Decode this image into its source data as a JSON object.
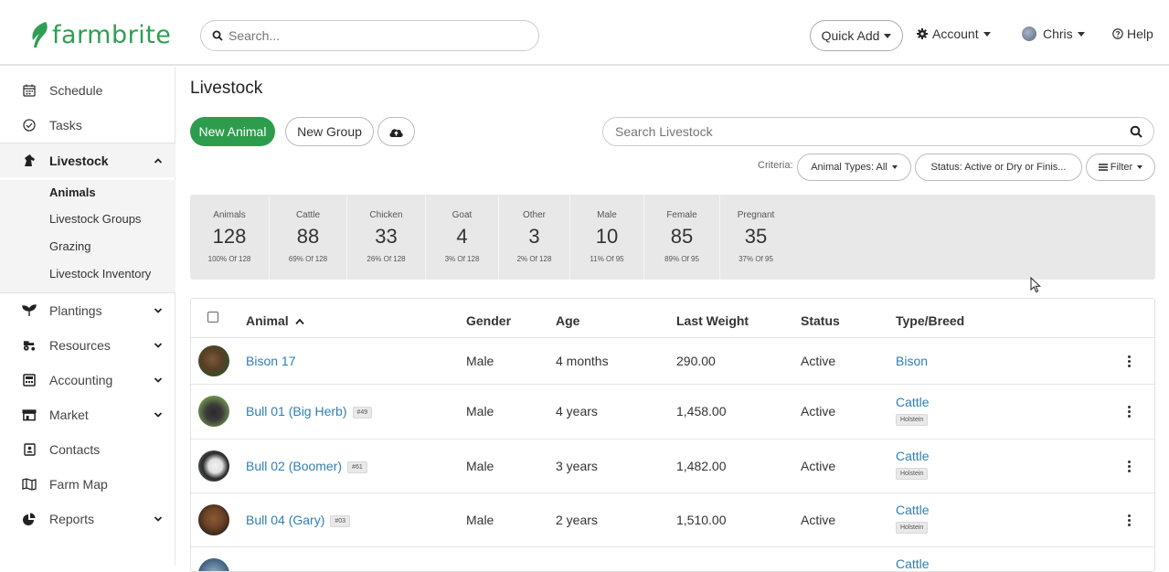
{
  "brand": {
    "name": "farmbrite",
    "color": "#2f9e52"
  },
  "topbar": {
    "search_placeholder": "Search...",
    "quick_add": "Quick Add",
    "account": "Account",
    "user": "Chris",
    "help": "Help"
  },
  "sidebar": {
    "items": [
      {
        "label": "Schedule",
        "icon": "calendar-icon"
      },
      {
        "label": "Tasks",
        "icon": "check-circle-icon"
      },
      {
        "label": "Livestock",
        "icon": "horse-head-icon",
        "active": true
      },
      {
        "label": "Plantings",
        "icon": "seedling-icon"
      },
      {
        "label": "Resources",
        "icon": "tractor-icon"
      },
      {
        "label": "Accounting",
        "icon": "calculator-icon"
      },
      {
        "label": "Market",
        "icon": "store-icon"
      },
      {
        "label": "Contacts",
        "icon": "address-book-icon"
      },
      {
        "label": "Farm Map",
        "icon": "map-icon"
      },
      {
        "label": "Reports",
        "icon": "pie-chart-icon"
      }
    ],
    "livestock_sub": [
      "Animals",
      "Livestock Groups",
      "Grazing",
      "Livestock Inventory"
    ]
  },
  "main": {
    "title": "Livestock",
    "new_animal": "New Animal",
    "new_group": "New Group",
    "search_placeholder": "Search Livestock",
    "criteria_label": "Criteria:",
    "criteria": [
      "Animal Types: All",
      "Status: Active or Dry or Finis...",
      "Filter"
    ]
  },
  "stats": [
    {
      "label": "Animals",
      "value": "128",
      "sub": "100% Of 128"
    },
    {
      "label": "Cattle",
      "value": "88",
      "sub": "69% Of 128"
    },
    {
      "label": "Chicken",
      "value": "33",
      "sub": "26% Of 128"
    },
    {
      "label": "Goat",
      "value": "4",
      "sub": "3% Of 128"
    },
    {
      "label": "Other",
      "value": "3",
      "sub": "2% Of 128"
    },
    {
      "label": "Male",
      "value": "10",
      "sub": "11% Of 95"
    },
    {
      "label": "Female",
      "value": "85",
      "sub": "89% Of 95"
    },
    {
      "label": "Pregnant",
      "value": "35",
      "sub": "37% Of 95"
    }
  ],
  "table": {
    "columns": [
      "Animal",
      "Gender",
      "Age",
      "Last Weight",
      "Status",
      "Type/Breed"
    ],
    "rows": [
      {
        "name": "Bison 17",
        "tag": "",
        "gender": "Male",
        "age": "4 months",
        "weight": "290.00",
        "status": "Active",
        "type": "Bison",
        "breed": ""
      },
      {
        "name": "Bull 01 (Big Herb)",
        "tag": "#49",
        "gender": "Male",
        "age": "4 years",
        "weight": "1,458.00",
        "status": "Active",
        "type": "Cattle",
        "breed": "Holstein"
      },
      {
        "name": "Bull 02 (Boomer)",
        "tag": "#61",
        "gender": "Male",
        "age": "3 years",
        "weight": "1,482.00",
        "status": "Active",
        "type": "Cattle",
        "breed": "Holstein"
      },
      {
        "name": "Bull 04 (Gary)",
        "tag": "#03",
        "gender": "Male",
        "age": "2 years",
        "weight": "1,510.00",
        "status": "Active",
        "type": "Cattle",
        "breed": "Holstein"
      },
      {
        "name": "",
        "tag": "",
        "gender": "",
        "age": "",
        "weight": "",
        "status": "",
        "type": "Cattle",
        "breed": ""
      }
    ]
  }
}
